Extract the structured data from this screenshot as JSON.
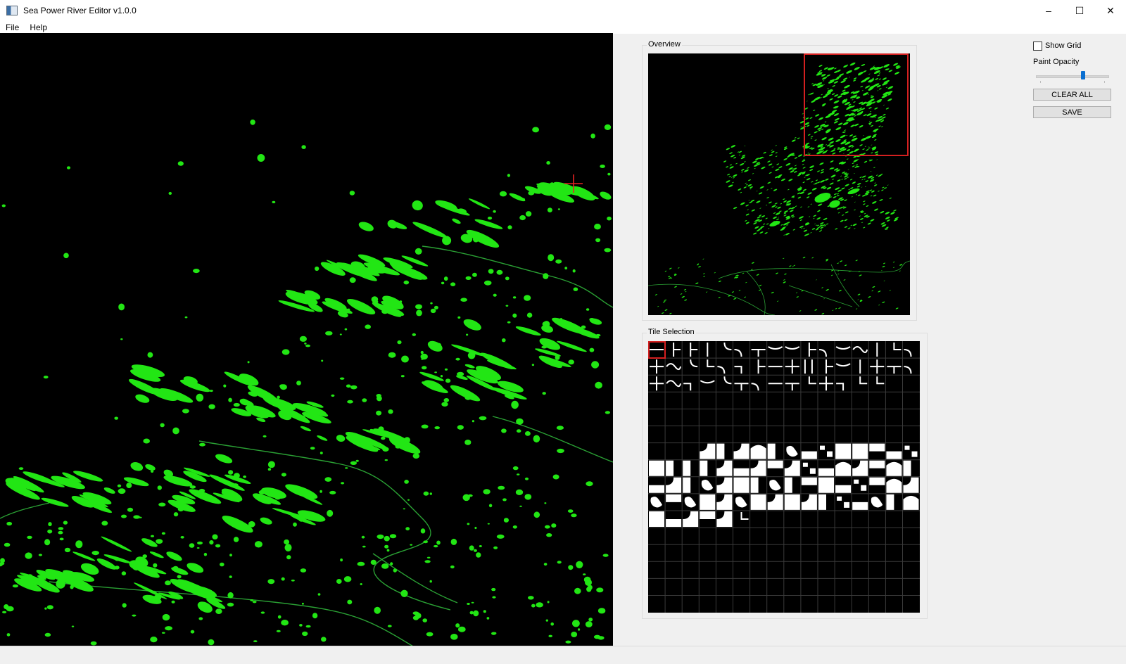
{
  "window": {
    "title": "Sea Power River Editor v1.0.0",
    "minimize": "–",
    "maximize": "☐",
    "close": "✕"
  },
  "menu": [
    {
      "label": "File"
    },
    {
      "label": "Help"
    }
  ],
  "overview": {
    "title": "Overview"
  },
  "tile_selection": {
    "title": "Tile Selection"
  },
  "controls": {
    "show_grid_label": "Show Grid",
    "show_grid_checked": false,
    "paint_opacity_label": "Paint Opacity",
    "paint_opacity_value": 0.65,
    "clear_all_label": "CLEAR ALL",
    "save_label": "SAVE"
  },
  "colors": {
    "paint": "#22e614",
    "river": "#2aa034",
    "cursor": "#e52222",
    "selection": "#d42020"
  }
}
